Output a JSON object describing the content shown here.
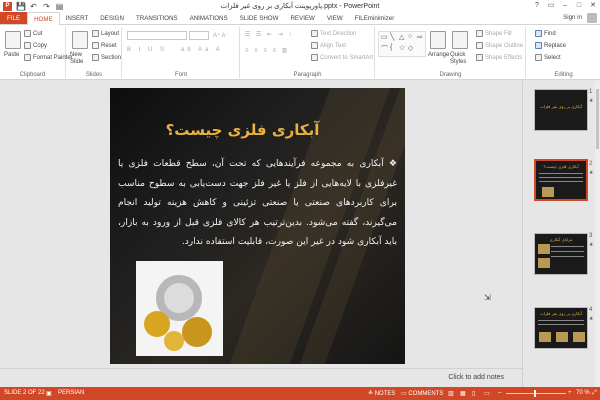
{
  "window": {
    "title": "پاورپوینت آبکاری بر روی غیر فلزات.pptx - PowerPoint",
    "controls": [
      "?",
      "▭",
      "–",
      "□",
      "✕"
    ]
  },
  "quick_access": {
    "logo": "P",
    "save": "💾",
    "undo": "↶",
    "redo": "↷",
    "present": "▤"
  },
  "tabs": [
    "FILE",
    "HOME",
    "INSERT",
    "DESIGN",
    "TRANSITIONS",
    "ANIMATIONS",
    "SLIDE SHOW",
    "REVIEW",
    "VIEW",
    "FILEminimizer"
  ],
  "active_tab": "HOME",
  "signin": "Sign in",
  "ribbon": {
    "clipboard": {
      "label": "Clipboard",
      "paste": "Paste",
      "cut": "Cut",
      "copy": "Copy",
      "format_painter": "Format Painter"
    },
    "slides": {
      "label": "Slides",
      "new_slide": "New Slide",
      "layout": "Layout",
      "reset": "Reset",
      "section": "Section"
    },
    "font": {
      "label": "Font"
    },
    "paragraph": {
      "label": "Paragraph",
      "text_direction": "Text Direction",
      "align_text": "Align Text",
      "convert_smartart": "Convert to SmartArt"
    },
    "drawing": {
      "label": "Drawing",
      "arrange": "Arrange",
      "quick_styles": "Quick Styles",
      "shape_fill": "Shape Fill",
      "shape_outline": "Shape Outline",
      "shape_effects": "Shape Effects"
    },
    "editing": {
      "label": "Editing",
      "find": "Find",
      "replace": "Replace",
      "select": "Select"
    }
  },
  "slide": {
    "title": "آبکاری فلزی چیست؟",
    "body": "❖ آبکاری به مجموعه فرآیندهایی که تحت آن، سطح قطعات فلزی یا غیرفلزی با لایه‌هایی از فلز یا غیر فلز جهت دست‌یابی به سطوح مناسب برای کاربردهای صنعتی یا صنعتی تزئینی و کاهش هزینه تولید انجام می‌گیرند، گفته می‌شود. بدین‌ترتیب هر کالای فلزی قبل از ورود به بازار، باید آبکاری شود در غیر این صورت، قابلیت استفاده ندارد."
  },
  "thumbnails": [
    {
      "num": "1",
      "title": "آبکاری بر روی غیر فلزات"
    },
    {
      "num": "2",
      "title": "آبکاری فلزی چیست؟"
    },
    {
      "num": "3",
      "title": "مزایای آبکاری"
    },
    {
      "num": "4",
      "title": "آبکاری بر روی غیر فلزات"
    }
  ],
  "notes_placeholder": "Click to add notes",
  "status": {
    "slide_count": "SLIDE 2 OF 22",
    "language": "PERSIAN",
    "notes": "NOTES",
    "comments": "COMMENTS",
    "zoom": "70 %"
  },
  "colors": {
    "accent": "#d24726",
    "title_gold": "#e9b23f"
  }
}
